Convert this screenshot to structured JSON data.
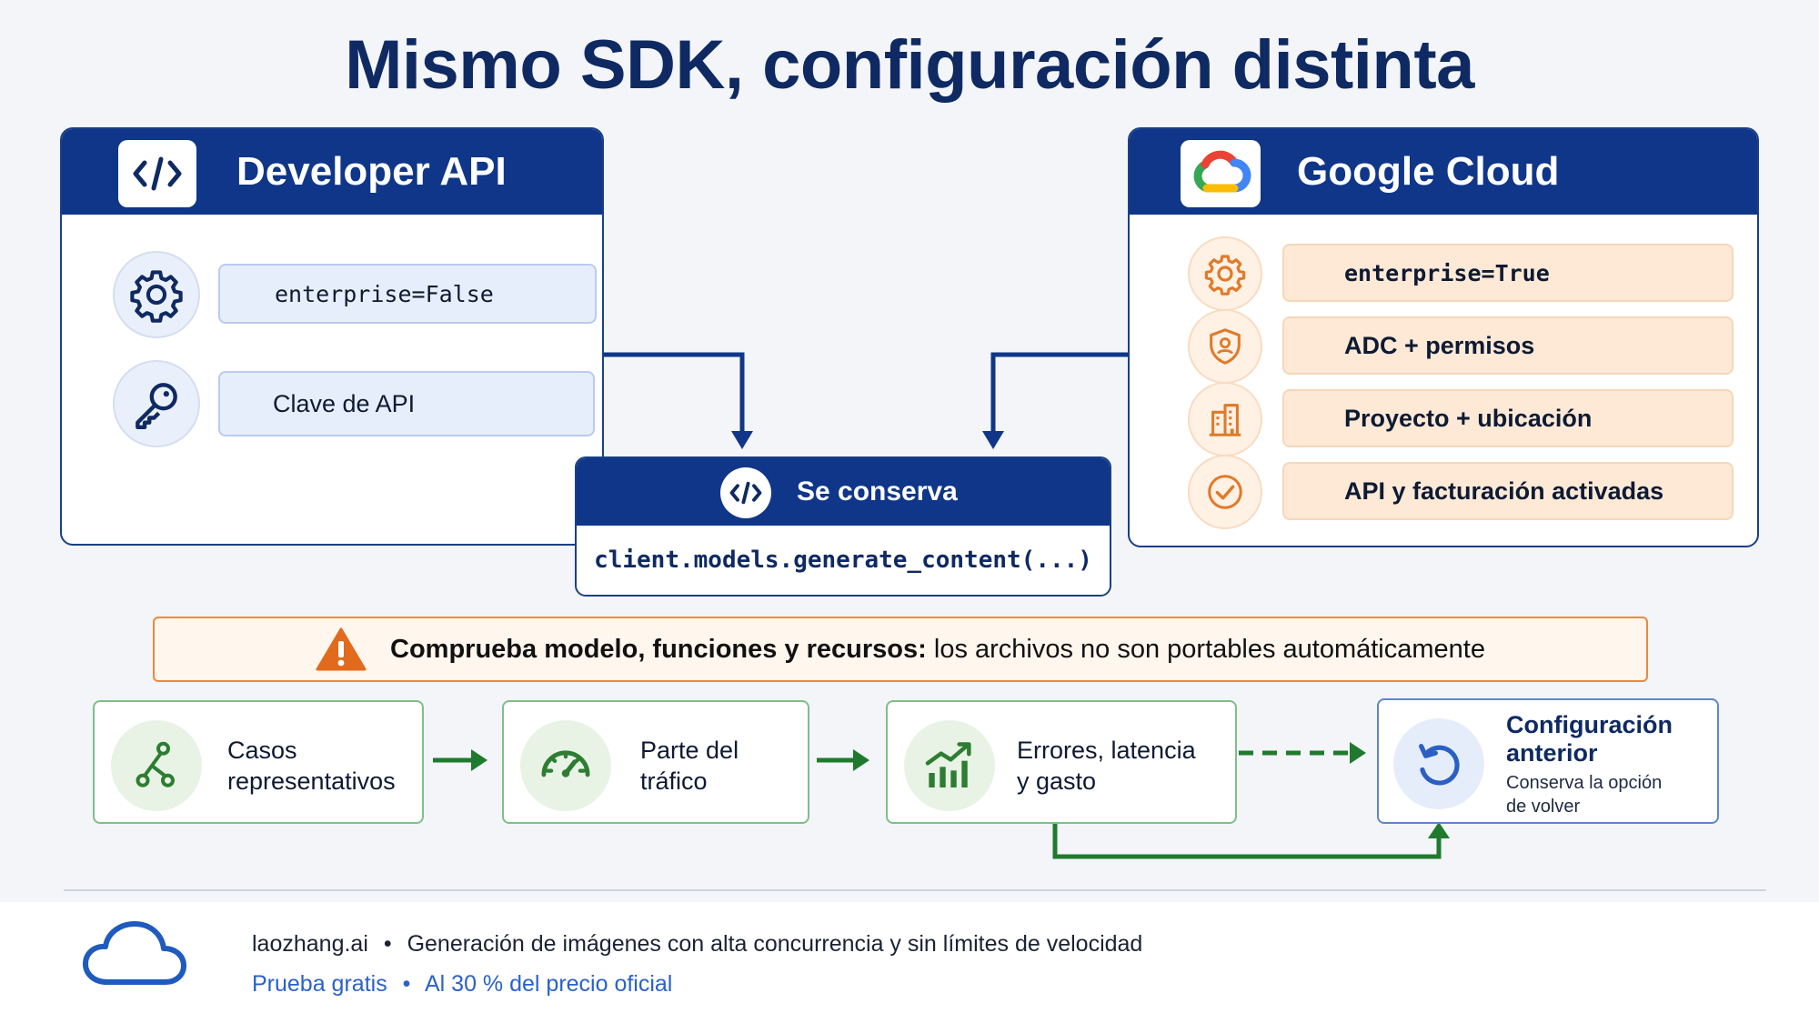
{
  "title": "Mismo SDK, configuración distinta",
  "left_panel": {
    "title": "Developer API",
    "logo_icon": "code-icon",
    "items": [
      {
        "icon": "gear-icon",
        "label": "enterprise=False"
      },
      {
        "icon": "key-icon",
        "label": "Clave de API"
      }
    ]
  },
  "right_panel": {
    "title": "Google Cloud",
    "logo_icon": "google-cloud-logo",
    "items": [
      {
        "icon": "gear-icon",
        "label": "enterprise=True"
      },
      {
        "icon": "shield-user-icon",
        "label": "ADC + permisos"
      },
      {
        "icon": "building-icon",
        "label": "Proyecto + ubicación"
      },
      {
        "icon": "check-circle-icon",
        "label": "API y facturación activadas"
      }
    ]
  },
  "center": {
    "title": "Se conserva",
    "code": "client.models.generate_content(...)"
  },
  "warning": {
    "bold": "Comprueba modelo, funciones y recursos:",
    "rest": " los archivos no son portables automáticamente"
  },
  "steps": [
    {
      "icon": "branch-icon",
      "line1": "Casos",
      "line2": "representativos"
    },
    {
      "icon": "gauge-icon",
      "line1": "Parte del",
      "line2": "tráfico"
    },
    {
      "icon": "chart-up-icon",
      "line1": "Errores, latencia",
      "line2": "y gasto"
    }
  ],
  "previous": {
    "icon": "undo-icon",
    "title_line1": "Configuración",
    "title_line2": "anterior",
    "sub_line1": "Conserva la opción",
    "sub_line2": "de volver"
  },
  "footer": {
    "brand": "laozhang.ai",
    "sep1": "•",
    "tagline": "Generación de imágenes con alta concurrencia y sin límites de velocidad",
    "link1": "Prueba gratis",
    "sep2": "•",
    "link2": "Al 30 % del precio oficial"
  },
  "colors": {
    "navy": "#0f3688",
    "green": "#1f7a2e",
    "orange": "#e07a2a",
    "link_blue": "#2a62c9"
  }
}
